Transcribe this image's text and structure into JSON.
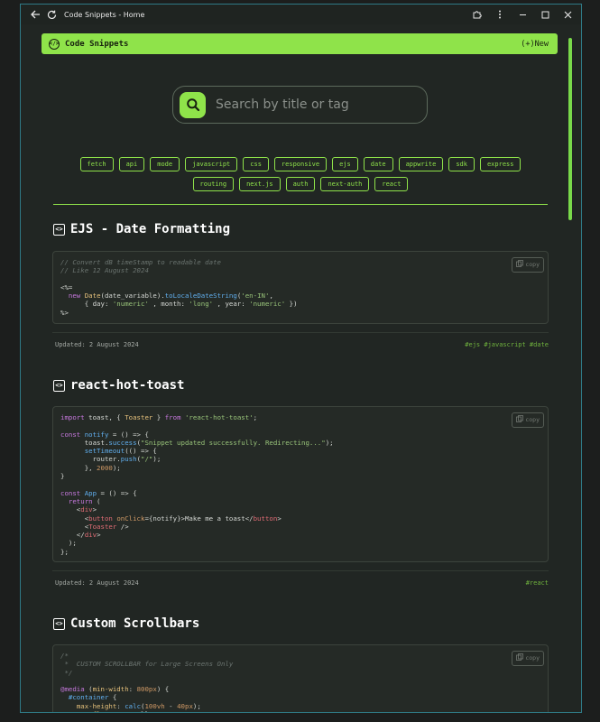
{
  "window": {
    "title": "Code Snippets - Home"
  },
  "navbar": {
    "brand": "Code Snippets",
    "new_label": "(+)New"
  },
  "search": {
    "placeholder": "Search by title or tag"
  },
  "tags": [
    "fetch",
    "api",
    "mode",
    "javascript",
    "css",
    "responsive",
    "ejs",
    "date",
    "appwrite",
    "sdk",
    "express",
    "routing",
    "next.js",
    "auth",
    "next-auth",
    "react"
  ],
  "snippets": [
    {
      "title": "EJS - Date Formatting",
      "copy_label": "copy",
      "updated": "Updated: 2 August 2024",
      "tags": "#ejs #javascript #date"
    },
    {
      "title": "react-hot-toast",
      "copy_label": "copy",
      "updated": "Updated: 2 August 2024",
      "tags": "#react"
    },
    {
      "title": "Custom Scrollbars",
      "copy_label": "copy"
    }
  ],
  "colors": {
    "accent": "#8fe34a",
    "background": "#212623",
    "border": "#2f7a86"
  },
  "icons": [
    "back-arrow-icon",
    "reload-icon",
    "extension-icon",
    "more-icon",
    "minimize-icon",
    "maximize-icon",
    "close-icon",
    "code-logo-icon",
    "search-icon",
    "code-icon",
    "copy-icon"
  ]
}
